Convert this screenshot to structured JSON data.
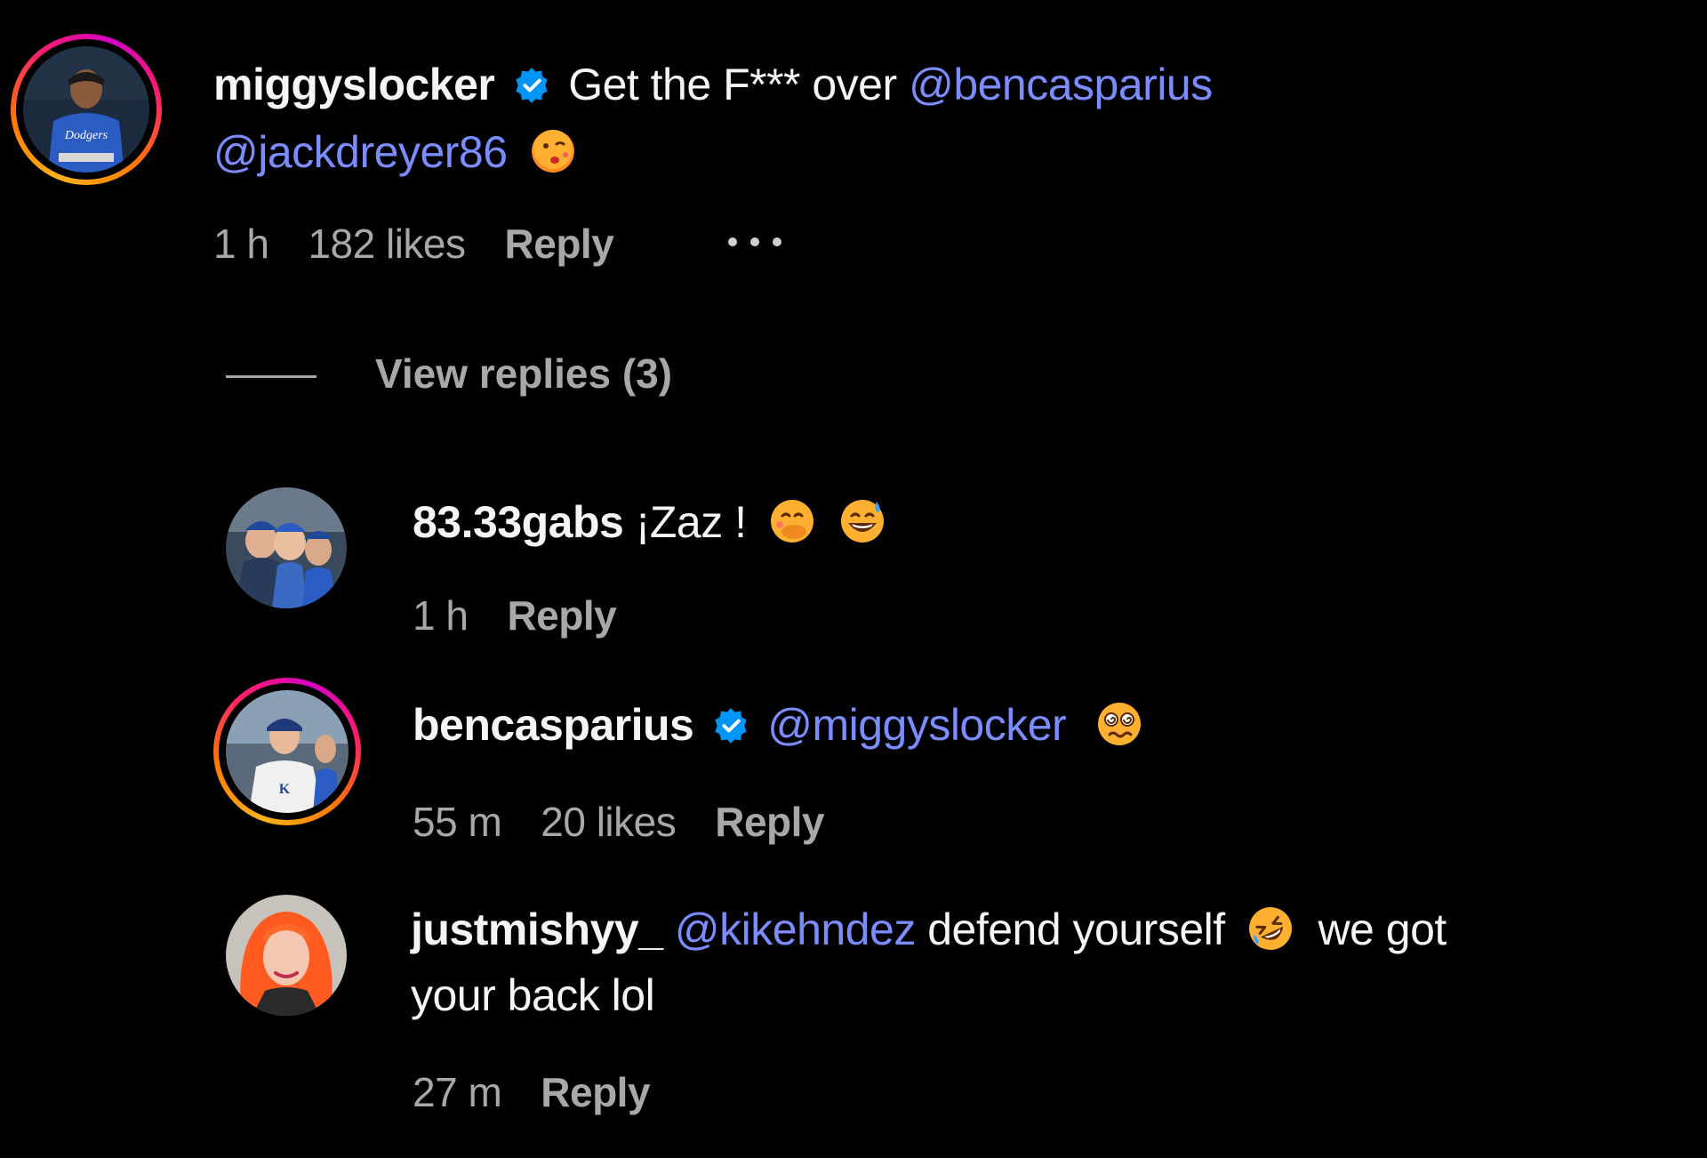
{
  "comments": [
    {
      "username": "miggyslocker",
      "verified": true,
      "text_before": "Get the F*** over",
      "mention1": "@bencasparius",
      "mention2": "@jackdreyer86",
      "emoji": "flirty-kiss-emoji",
      "time": "1 h",
      "likes": "182 likes",
      "reply": "Reply",
      "more": "..."
    }
  ],
  "view_replies": "View replies (3)",
  "replies": [
    {
      "username": "83.33gabs",
      "text": "¡Zaz !",
      "emojis": [
        "face-with-hand-over-mouth-emoji",
        "grinning-sweat-emoji"
      ],
      "time": "1 h",
      "reply": "Reply"
    },
    {
      "username": "bencasparius",
      "verified": true,
      "mention": "@miggyslocker",
      "emoji": "woozy-dizzy-face-emoji",
      "time": "55 m",
      "likes": "20 likes",
      "reply": "Reply"
    },
    {
      "username": "justmishyy_",
      "mention": "@kikehndez",
      "text1": "defend yourself",
      "emoji": "rolling-laughing-emoji",
      "text2": "we got",
      "text3": "your back lol",
      "time": "27 m",
      "reply": "Reply"
    }
  ],
  "colors": {
    "background": "#000000",
    "text": "#f5f5f5",
    "secondary": "#a8a8a8",
    "mention": "#7b8cff",
    "verified": "#0095f6"
  }
}
